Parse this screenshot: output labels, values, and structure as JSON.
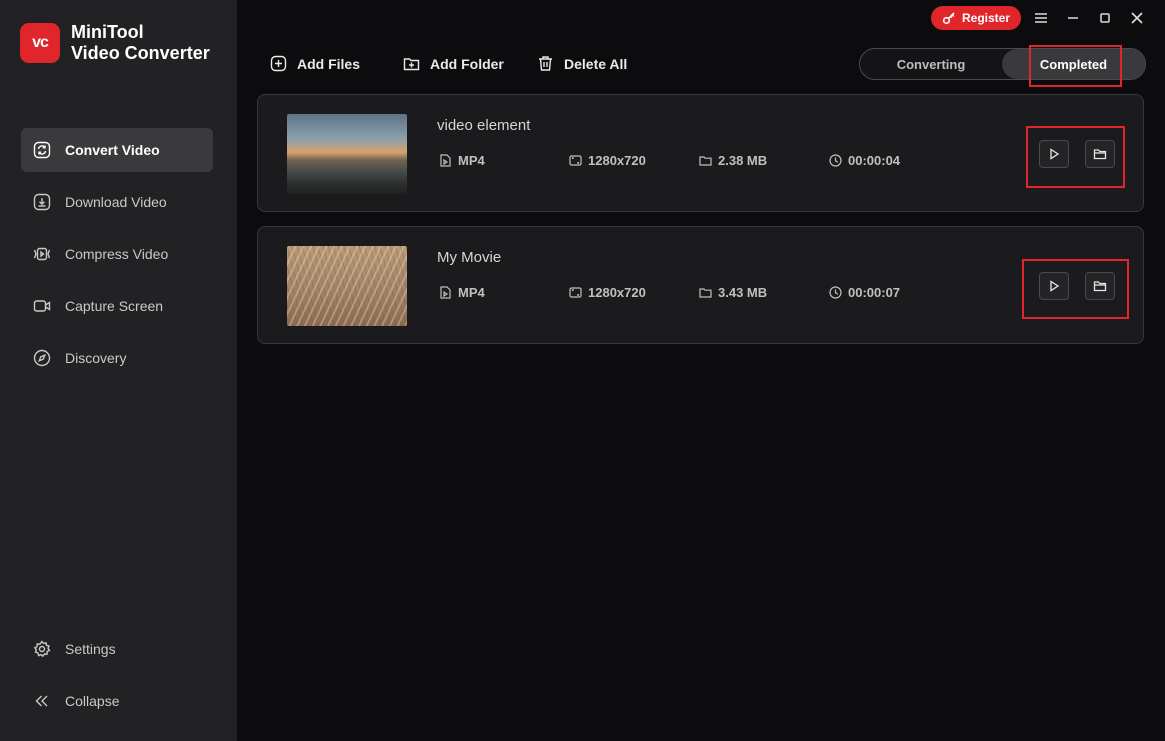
{
  "app": {
    "name_line1": "MiniTool",
    "name_line2": "Video Converter",
    "logo_letters": "vc"
  },
  "titlebar": {
    "register_label": "Register"
  },
  "sidebar": {
    "items": [
      {
        "label": "Convert Video",
        "icon": "convert-icon",
        "active": true
      },
      {
        "label": "Download Video",
        "icon": "download-icon"
      },
      {
        "label": "Compress Video",
        "icon": "compress-icon"
      },
      {
        "label": "Capture Screen",
        "icon": "camera-icon"
      },
      {
        "label": "Discovery",
        "icon": "compass-icon"
      }
    ],
    "bottom": [
      {
        "label": "Settings",
        "icon": "gear-icon"
      },
      {
        "label": "Collapse",
        "icon": "double-chevron-left-icon"
      }
    ]
  },
  "toolbar": {
    "add_files": "Add Files",
    "add_folder": "Add Folder",
    "delete_all": "Delete All"
  },
  "tabs": {
    "converting": "Converting",
    "completed": "Completed",
    "selected": "Completed"
  },
  "files": [
    {
      "title": "video element",
      "format": "MP4",
      "resolution": "1280x720",
      "size": "2.38 MB",
      "duration": "00:00:04"
    },
    {
      "title": "My Movie",
      "format": "MP4",
      "resolution": "1280x720",
      "size": "3.43 MB",
      "duration": "00:00:07"
    }
  ],
  "colors": {
    "accent": "#e0262b",
    "sidebar_bg": "#222224",
    "main_bg": "#0c0c0e",
    "card_bg": "#1b1b1d"
  }
}
